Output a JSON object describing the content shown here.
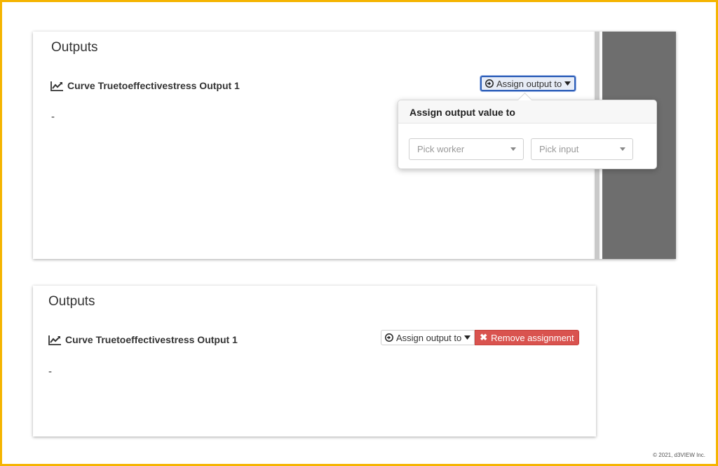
{
  "panel_top": {
    "title": "Outputs",
    "output_label": "Curve Truetoeffectivestress Output 1",
    "value": "-",
    "assign_button_label": "Assign output to",
    "popover": {
      "title": "Assign output value to",
      "worker_placeholder": "Pick worker",
      "input_placeholder": "Pick input"
    }
  },
  "panel_bottom": {
    "title": "Outputs",
    "output_label": "Curve Truetoeffectivestress Output 1",
    "value": "-",
    "assign_button_label": "Assign output to",
    "remove_button_label": "Remove assignment"
  },
  "footer": {
    "copyright": "© 2021, d3VIEW Inc."
  },
  "colors": {
    "frame_border": "#f5b400",
    "danger": "#d9534f",
    "active_blue": "#2e5fb8"
  },
  "icons": {
    "chart": "line-chart-icon",
    "assign": "arrow-circle-right-icon",
    "caret": "caret-down-icon",
    "remove": "times-icon"
  }
}
